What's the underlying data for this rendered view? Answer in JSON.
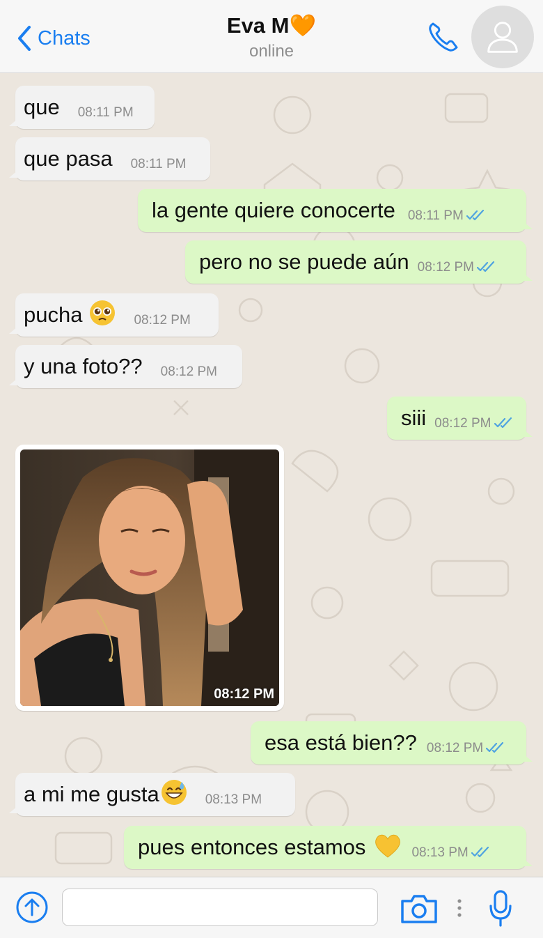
{
  "header": {
    "back_label": "Chats",
    "contact_name": "Eva M",
    "contact_emoji": "🧡",
    "status": "online"
  },
  "messages": [
    {
      "text": "que",
      "time": "08:11 PM",
      "direction": "in"
    },
    {
      "text": "que pasa",
      "time": "08:11 PM",
      "direction": "in"
    },
    {
      "text": "la gente quiere conocerte",
      "time": "08:11 PM",
      "direction": "out"
    },
    {
      "text": "pero no se puede aún",
      "time": "08:12 PM",
      "direction": "out"
    },
    {
      "text": "pucha",
      "emoji": "pleading-face",
      "time": "08:12 PM",
      "direction": "in"
    },
    {
      "text": "y una foto??",
      "time": "08:12 PM",
      "direction": "in"
    },
    {
      "text": "siii",
      "time": "08:12 PM",
      "direction": "out"
    },
    {
      "type": "photo",
      "time": "08:12 PM",
      "direction": "in"
    },
    {
      "text": "esa está bien??",
      "time": "08:12 PM",
      "direction": "out"
    },
    {
      "text": "a mi me gusta",
      "emoji": "grinning-sweat-face",
      "time": "08:13 PM",
      "direction": "in"
    },
    {
      "text": "pues entonces estamos",
      "emoji": "yellow-heart",
      "time": "08:13 PM",
      "direction": "out"
    }
  ],
  "colors": {
    "accent": "#1a7ef0",
    "outgoing_bubble": "#dcf8c6",
    "incoming_bubble": "#f2f2f2",
    "read_ticks": "#4fa3e0",
    "chat_background": "#ece6de"
  },
  "icons": [
    "chevron-left-icon",
    "phone-icon",
    "user-avatar-icon",
    "upload-arrow-icon",
    "camera-icon",
    "more-dots-icon",
    "microphone-icon",
    "double-check-icon"
  ]
}
